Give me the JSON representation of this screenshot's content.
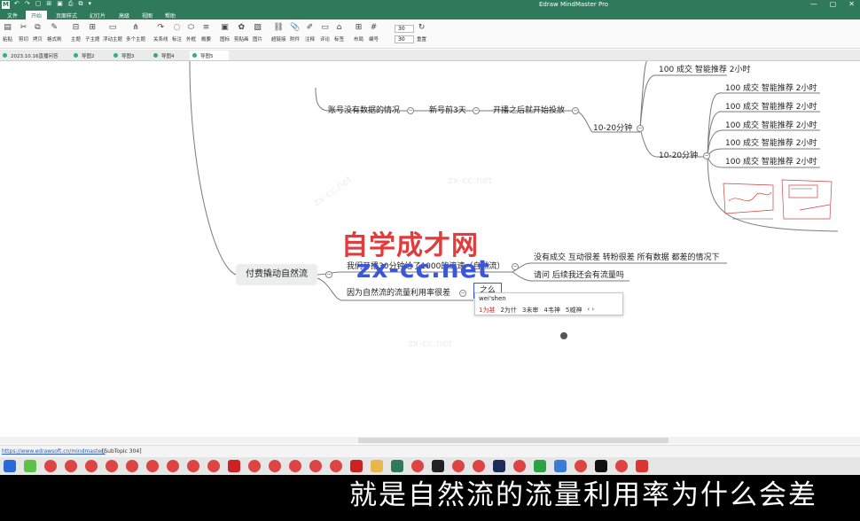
{
  "titlebar": {
    "app_title": "Edraw MindMaster Pro",
    "logo_text": "M",
    "quick_icons": [
      "↶",
      "↷",
      "▢",
      "⊞",
      "▣",
      "⎙",
      "⧉",
      "▾"
    ],
    "win": [
      "—",
      "▢",
      "✕"
    ]
  },
  "menubar": {
    "items": [
      "文件",
      "开始",
      "页面样式",
      "幻灯片",
      "高级",
      "视图",
      "帮助"
    ],
    "active": "开始"
  },
  "ribbon": {
    "tools": [
      {
        "icon": "▤",
        "label": "粘贴"
      },
      {
        "icon": "✂",
        "label": "剪切"
      },
      {
        "icon": "⧉",
        "label": "拷贝"
      },
      {
        "icon": "✎",
        "label": "格式刷"
      },
      {
        "icon": "⊟",
        "label": "主题"
      },
      {
        "icon": "⊞",
        "label": "子主题"
      },
      {
        "icon": "▭",
        "label": "浮动主题"
      },
      {
        "icon": "⋔",
        "label": "多个主题"
      },
      {
        "icon": "↷",
        "label": "关系线"
      },
      {
        "icon": "◌",
        "label": "标注"
      },
      {
        "icon": "⬭",
        "label": "外框"
      },
      {
        "icon": "≡",
        "label": "概要"
      },
      {
        "icon": "▣",
        "label": "图标"
      },
      {
        "icon": "✿",
        "label": "剪贴画"
      },
      {
        "icon": "▨",
        "label": "图片"
      },
      {
        "icon": "⛓",
        "label": "超链接"
      },
      {
        "icon": "📎",
        "label": "附件"
      },
      {
        "icon": "✐",
        "label": "注释"
      },
      {
        "icon": "▭",
        "label": "评论"
      },
      {
        "icon": "⌂",
        "label": "标签"
      },
      {
        "icon": "⊞",
        "label": "布局"
      },
      {
        "icon": "#",
        "label": "编号"
      },
      {
        "icon": "⇕",
        "label": ""
      },
      {
        "icon": "↻",
        "label": "重置"
      }
    ],
    "spin1": "30",
    "spin2": "30"
  },
  "doc_tabs": [
    "2023.10.16直播问答",
    "导图2",
    "导图3",
    "导图4",
    "导图5"
  ],
  "mindmap": {
    "center": "付费撬动自然流",
    "nodes": {
      "n_acct": "账号没有数据的情况",
      "n_newacct": "新号前3天",
      "n_start": "开播之后就开始投放",
      "n_1020a": "10-20分钟",
      "n_1020b": "10-20分钟",
      "n_top": "100 成交 智能推荐 2小时",
      "n_r1": "100 成交 智能推荐 2小时",
      "n_r2": "100 成交 智能推荐 2小时",
      "n_r3": "100 成交 智能推荐 2小时",
      "n_r4": "100 成交 智能推荐 2小时",
      "n_r5": "100 成交 智能推荐 2小时",
      "n_30min": "我们开播30分钟给了1000的流速（自然流）",
      "n_nodeal": "没有成交  互动很差 转粉很差 所有数据 都差的情况下",
      "n_ask": "请问  后续我还会有流量吗",
      "n_why": "因为自然流的流量利用率很差",
      "n_edit": "之么"
    }
  },
  "watermark": {
    "cn": "自学成才网",
    "en": "zx-cc.net",
    "faint": "zx-cc.net"
  },
  "ime": {
    "pinyin": "wei'shen",
    "candidates": [
      "1为甚",
      "2为什",
      "3未审",
      "4韦神",
      "5威神"
    ],
    "nav": "‹ ›"
  },
  "status": {
    "url": "https://www.edrawsoft.cn/mindmaster/",
    "topic": "[SubTopic 304]"
  },
  "caption": "就是自然流的流量利用率为什么会差",
  "colors": {
    "brand": "#2f7a5a",
    "line": "#7a7a7a",
    "wm_red": "#e33b3b",
    "wm_blue": "#3b57d6"
  }
}
